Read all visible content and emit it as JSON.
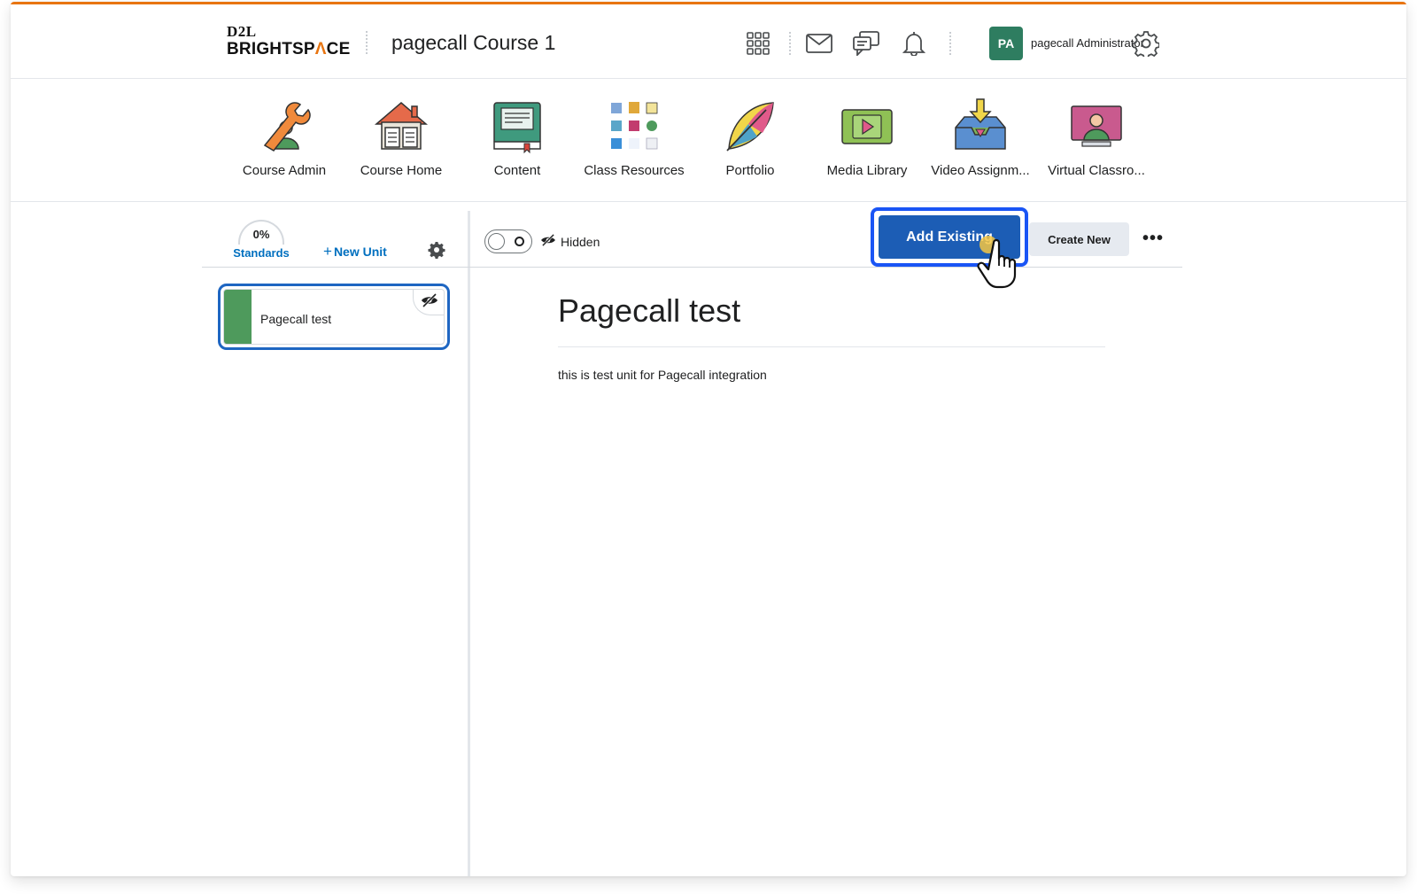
{
  "header": {
    "logo_top": "D2L",
    "logo_bottom_pre": "BRIGHTSP",
    "logo_bottom_mark": "Λ",
    "logo_bottom_post": "CE",
    "course_title": "pagecall Course 1",
    "avatar_initials": "PA",
    "user_name": "pagecall Administrator",
    "icons": [
      "grid-icon",
      "mail-icon",
      "chat-icon",
      "bell-icon",
      "gear-icon"
    ]
  },
  "navbar": {
    "items": [
      {
        "label": "Course Admin",
        "icon": "wrench-person-icon"
      },
      {
        "label": "Course Home",
        "icon": "house-book-icon"
      },
      {
        "label": "Content",
        "icon": "book-icon"
      },
      {
        "label": "Class Resources",
        "icon": "resources-grid-icon"
      },
      {
        "label": "Portfolio",
        "icon": "leaf-icon"
      },
      {
        "label": "Media Library",
        "icon": "play-icon"
      },
      {
        "label": "Video Assignm...",
        "icon": "inbox-download-icon"
      },
      {
        "label": "Virtual Classro...",
        "icon": "monitor-person-icon"
      }
    ]
  },
  "sidebar": {
    "standards_percent": "0%",
    "standards_label": "Standards",
    "new_unit_label": "New Unit",
    "units": [
      {
        "title": "Pagecall test",
        "color": "#4e9a5c",
        "hidden": true
      }
    ]
  },
  "toolbar": {
    "visibility_label": "Hidden",
    "add_existing_label": "Add Existing",
    "create_new_label": "Create New",
    "more_label": "•••"
  },
  "main": {
    "unit_title": "Pagecall test",
    "unit_description": "this is test unit for Pagecall integration"
  },
  "colors": {
    "accent": "#e87511",
    "primary_button": "#1c5db5",
    "highlight_ring": "#1a55f5",
    "link": "#006fbf",
    "avatar": "#2e7d60"
  }
}
